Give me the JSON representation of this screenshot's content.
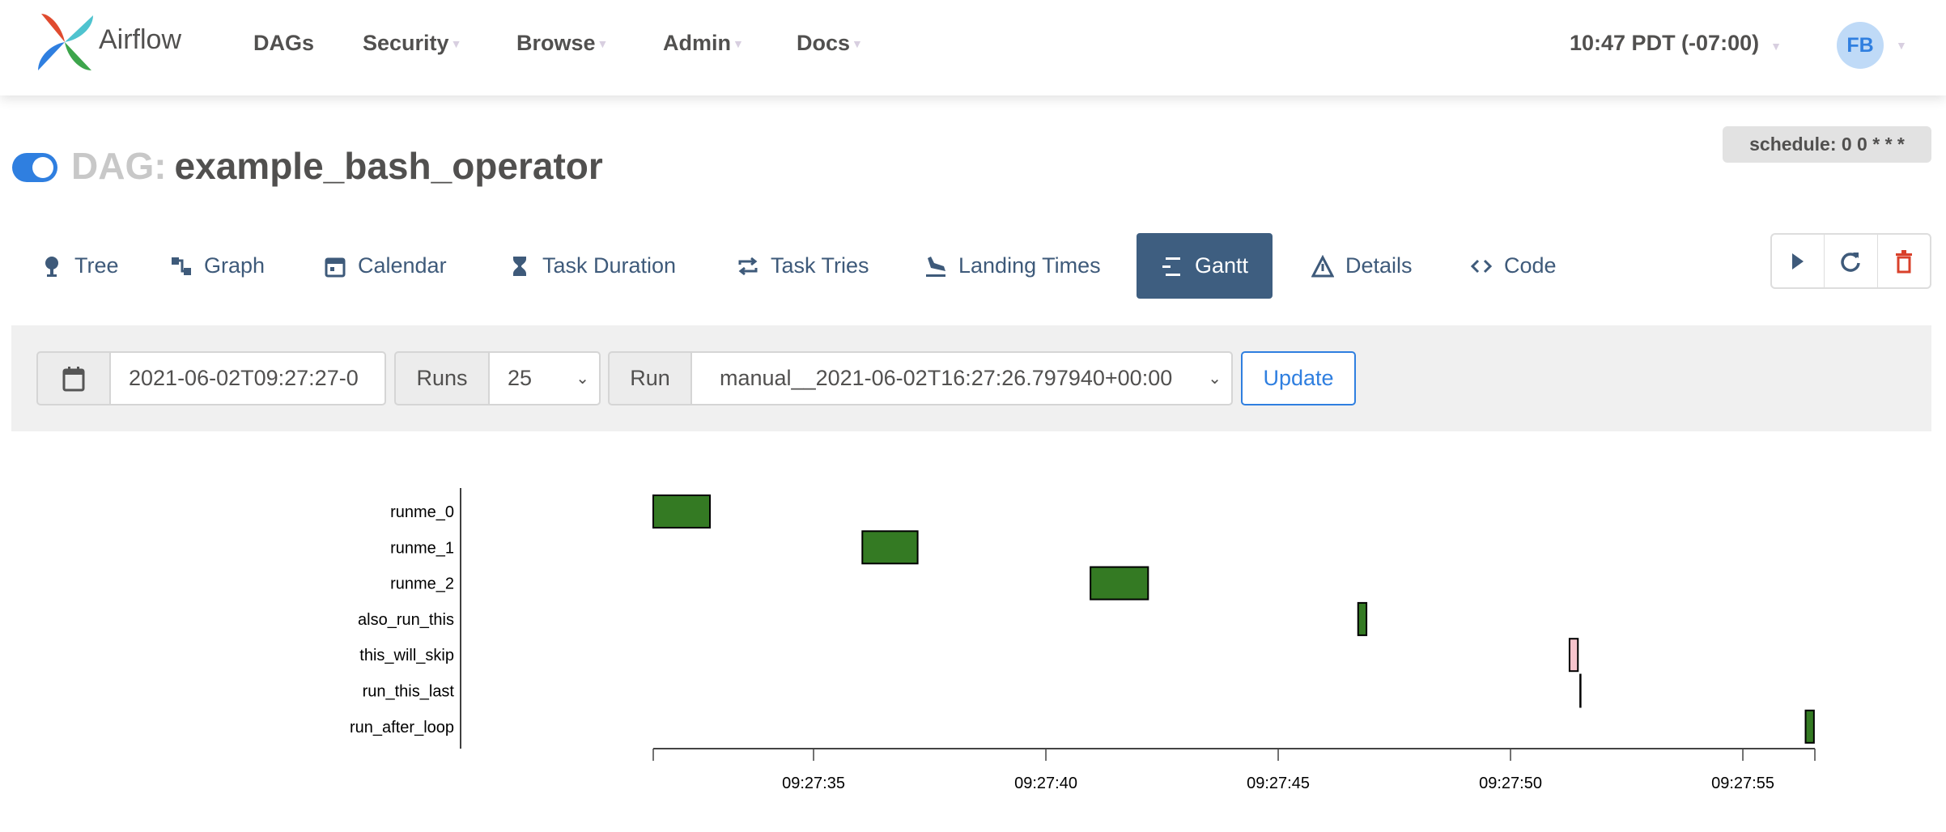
{
  "navbar": {
    "brand": "Airflow",
    "items": [
      {
        "label": "DAGs",
        "dropdown": false
      },
      {
        "label": "Security",
        "dropdown": true
      },
      {
        "label": "Browse",
        "dropdown": true
      },
      {
        "label": "Admin",
        "dropdown": true
      },
      {
        "label": "Docs",
        "dropdown": true
      }
    ],
    "time": "10:47 PDT (-07:00)",
    "user_initials": "FB"
  },
  "dag": {
    "prefix": "DAG:",
    "name": "example_bash_operator",
    "paused": false,
    "schedule": "schedule: 0 0 * * *"
  },
  "tabs": [
    {
      "label": "Tree",
      "icon": "tree-icon"
    },
    {
      "label": "Graph",
      "icon": "graph-icon"
    },
    {
      "label": "Calendar",
      "icon": "calendar-icon"
    },
    {
      "label": "Task Duration",
      "icon": "hourglass-icon"
    },
    {
      "label": "Task Tries",
      "icon": "repeat-icon"
    },
    {
      "label": "Landing Times",
      "icon": "plane-landing-icon"
    },
    {
      "label": "Gantt",
      "icon": "gantt-icon",
      "active": true
    },
    {
      "label": "Details",
      "icon": "warning-triangle-icon"
    },
    {
      "label": "Code",
      "icon": "code-icon"
    }
  ],
  "actions": {
    "trigger": "play-icon",
    "refresh": "refresh-icon",
    "delete": "trash-icon"
  },
  "form": {
    "base_date": "2021-06-02T09:27:27-0",
    "runs_label": "Runs",
    "runs_value": "25",
    "run_label": "Run",
    "run_value": "manual__2021-06-02T16:27:26.797940+00:00",
    "update_label": "Update"
  },
  "colors": {
    "success": "#347a23",
    "skipped": "#f7c4cc",
    "accent": "#2f7fe0",
    "tab_active": "#3e5e80"
  },
  "chart_data": {
    "type": "gantt",
    "x_range": [
      "09:27:31.55",
      "09:27:56.55"
    ],
    "x_ticks": [
      "09:27:35",
      "09:27:40",
      "09:27:45",
      "09:27:50",
      "09:27:55"
    ],
    "tasks": [
      {
        "name": "runme_0",
        "start": "09:27:31.55",
        "end": "09:27:32.77",
        "state": "success"
      },
      {
        "name": "runme_1",
        "start": "09:27:36.05",
        "end": "09:27:37.24",
        "state": "success"
      },
      {
        "name": "runme_2",
        "start": "09:27:40.96",
        "end": "09:27:42.20",
        "state": "success"
      },
      {
        "name": "also_run_this",
        "start": "09:27:46.72",
        "end": "09:27:46.90",
        "state": "success"
      },
      {
        "name": "this_will_skip",
        "start": "09:27:51.27",
        "end": "09:27:51.45",
        "state": "skipped"
      },
      {
        "name": "run_this_last",
        "start": "09:27:51.50",
        "end": "09:27:51.50",
        "state": "skipped"
      },
      {
        "name": "run_after_loop",
        "start": "09:27:56.35",
        "end": "09:27:56.53",
        "state": "success"
      }
    ]
  }
}
